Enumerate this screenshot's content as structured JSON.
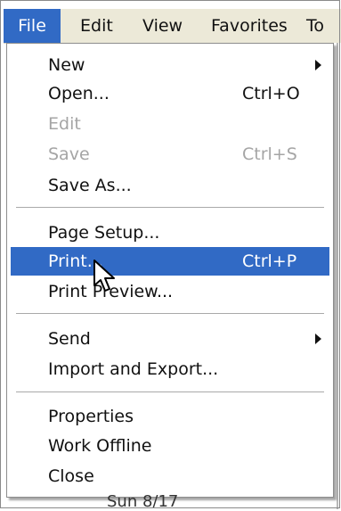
{
  "menubar": {
    "items": [
      "File",
      "Edit",
      "View",
      "Favorites",
      "To"
    ]
  },
  "file_menu": {
    "items": [
      {
        "label": "New",
        "shortcut": "",
        "submenu": true
      },
      {
        "label": "Open...",
        "shortcut": "Ctrl+O"
      },
      {
        "label": "Edit",
        "shortcut": "",
        "disabled": true
      },
      {
        "label": "Save",
        "shortcut": "Ctrl+S",
        "disabled": true
      },
      {
        "label": "Save As...",
        "shortcut": ""
      },
      {
        "label": "Page Setup...",
        "shortcut": ""
      },
      {
        "label": "Print...",
        "shortcut": "Ctrl+P",
        "highlighted": true
      },
      {
        "label": "Print Preview...",
        "shortcut": ""
      },
      {
        "label": "Send",
        "shortcut": "",
        "submenu": true
      },
      {
        "label": "Import and Export...",
        "shortcut": ""
      },
      {
        "label": "Properties",
        "shortcut": ""
      },
      {
        "label": "Work Offline",
        "shortcut": ""
      },
      {
        "label": "Close",
        "shortcut": ""
      }
    ]
  },
  "background": {
    "bottom_text": "Sun 8/17"
  },
  "colors": {
    "highlight": "#316ac5",
    "menubar": "#ece9d8",
    "disabled_text": "#a5a5a5"
  }
}
